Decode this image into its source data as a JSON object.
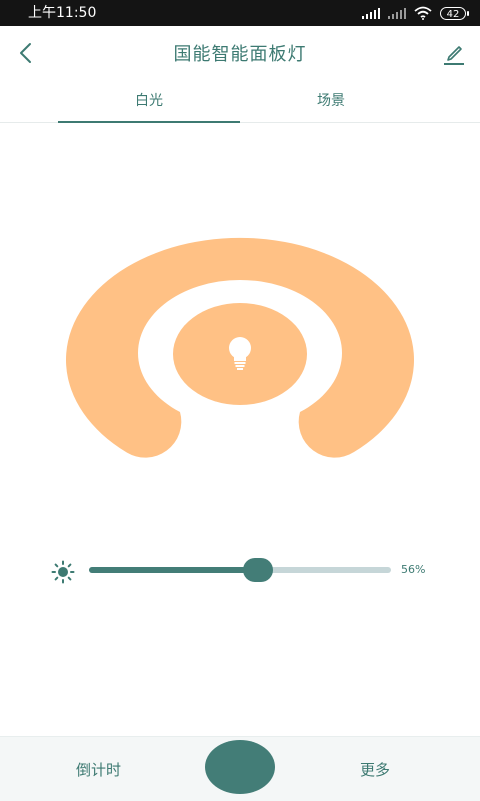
{
  "status_bar": {
    "time": "上午11:50",
    "battery": "42"
  },
  "header": {
    "title": "国能智能面板灯"
  },
  "tabs": [
    {
      "label": "白光",
      "active": true
    },
    {
      "label": "场景",
      "active": false
    }
  ],
  "lamp": {
    "color": "#ffc185",
    "icon": "light-bulb-icon"
  },
  "brightness": {
    "value": 56,
    "label": "56%"
  },
  "bottom_bar": {
    "left_label": "倒计时",
    "right_label": "更多"
  },
  "colors": {
    "accent": "#437d77",
    "text": "#3d7a72",
    "lamp": "#ffc185"
  }
}
